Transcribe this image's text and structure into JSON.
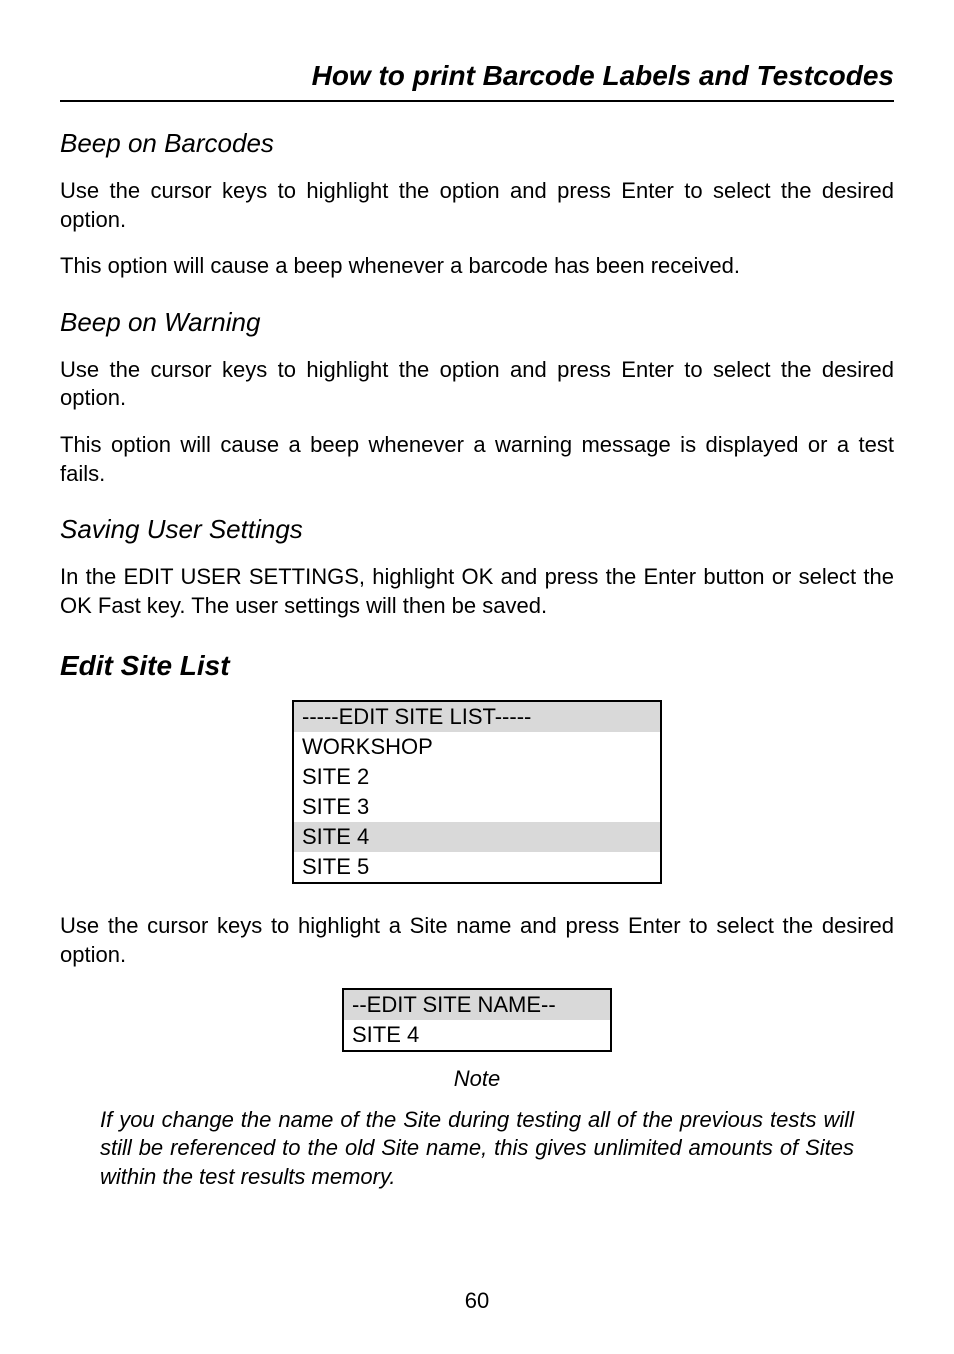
{
  "header": {
    "title": "How to print Barcode Labels and Testcodes"
  },
  "sections": {
    "beep_barcodes": {
      "heading": "Beep on Barcodes",
      "p1": "Use the cursor keys to highlight the option and press Enter to select the desired option.",
      "p2": "This option will cause a beep whenever a barcode has been received."
    },
    "beep_warning": {
      "heading": "Beep on Warning",
      "p1": "Use the cursor keys to highlight the option and press Enter to select the desired option.",
      "p2": "This option will cause a beep whenever a warning message is displayed or a test fails."
    },
    "saving_settings": {
      "heading": "Saving User Settings",
      "p1": "In the EDIT USER SETTINGS, highlight OK and press the Enter button or select the OK Fast key.  The user settings will then be saved."
    },
    "edit_site_list": {
      "heading": "Edit Site List",
      "table": {
        "header": "-----EDIT SITE LIST-----",
        "rows": [
          "WORKSHOP",
          "SITE 2",
          "SITE 3",
          "SITE 4",
          "SITE 5"
        ]
      },
      "p1": "Use the cursor keys to highlight a Site name and press Enter to select the desired option.",
      "edit_name_table": {
        "header": "--EDIT SITE NAME--",
        "value": "SITE 4"
      }
    },
    "note": {
      "label": "Note",
      "text": "If you change the name of the Site during testing all of the previous tests will still be referenced to the old Site name, this gives unlimited amounts of Sites within the test results memory."
    }
  },
  "page_number": "60"
}
